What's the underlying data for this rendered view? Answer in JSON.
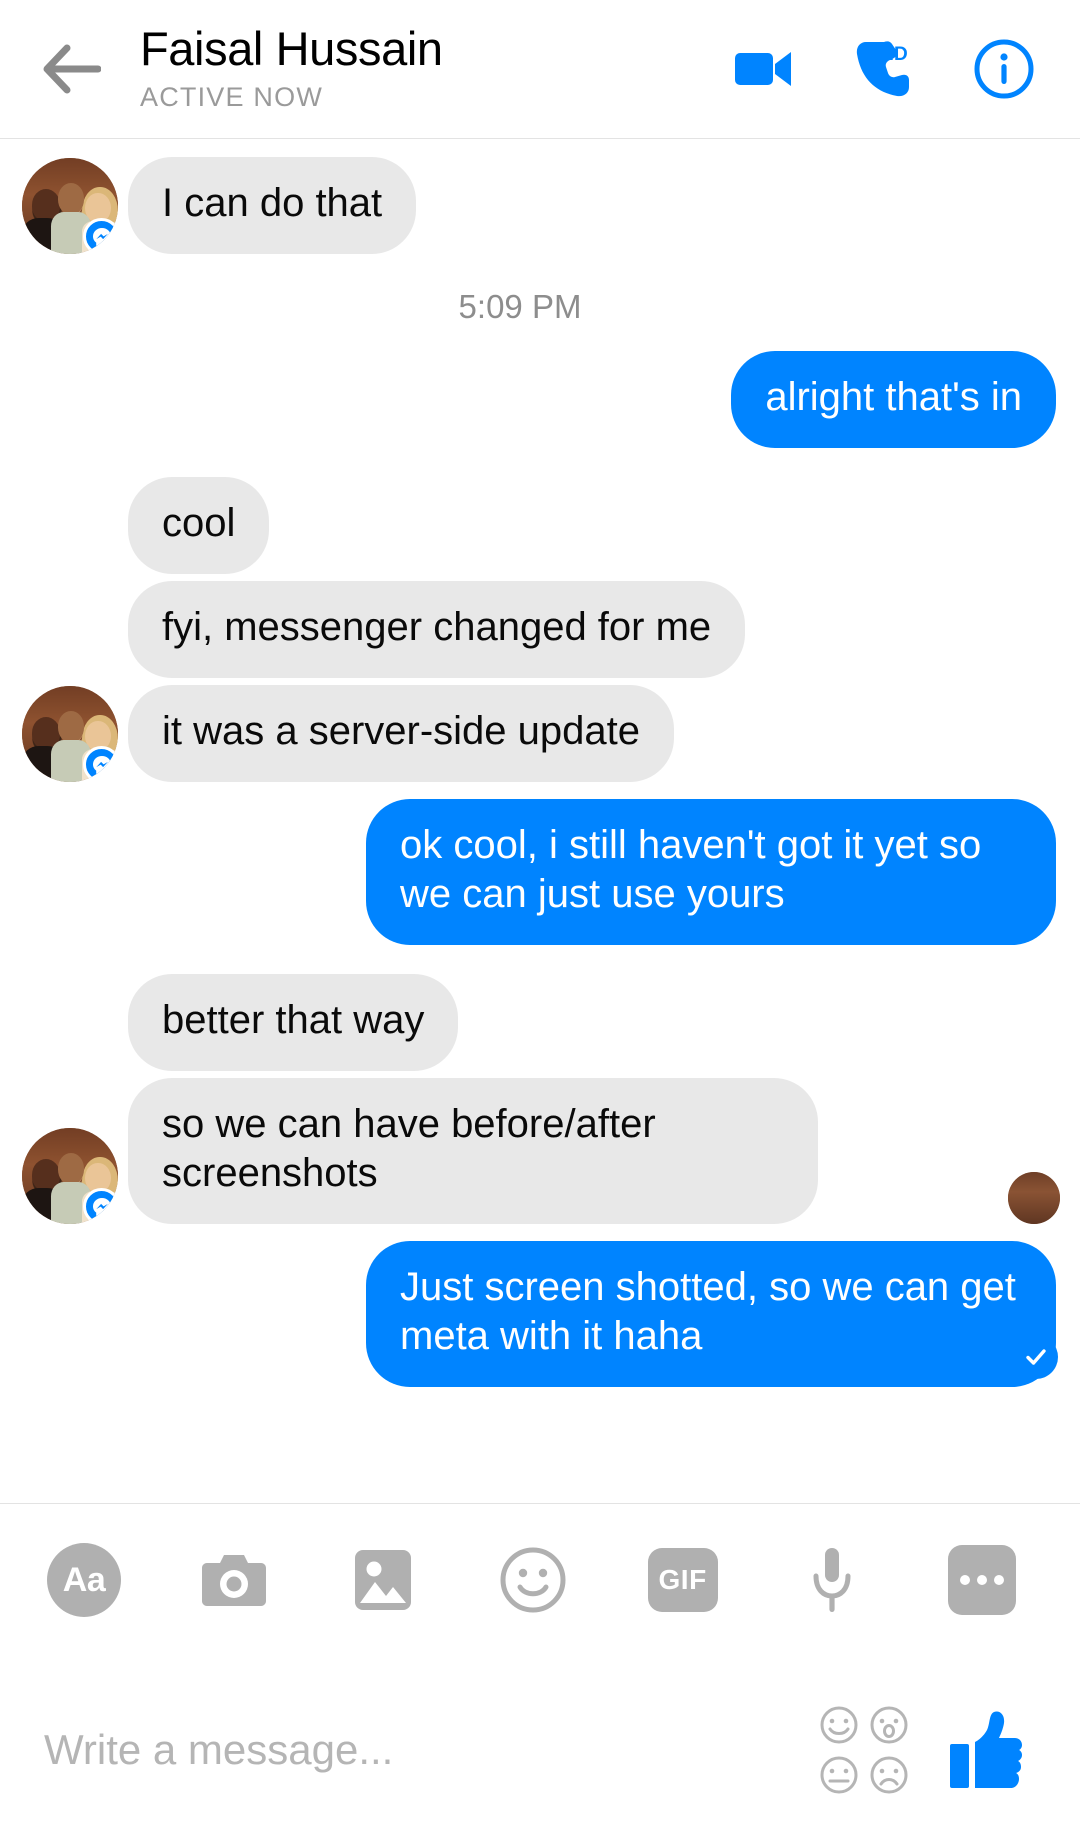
{
  "header": {
    "back_icon": "arrow-left-icon",
    "contact_name": "Faisal Hussain",
    "status": "ACTIVE NOW",
    "video_call_icon": "video-camera-icon",
    "audio_call_icon": "phone-hd-icon",
    "info_icon": "info-circle-icon",
    "accent_color": "#0084ff"
  },
  "thread": {
    "timestamp": "5:09 PM",
    "messages": [
      {
        "id": "m1",
        "side": "in",
        "text": "I can do that",
        "avatar": true,
        "lines": 1
      },
      {
        "id": "m2",
        "side": "out",
        "text": "alright that's in",
        "avatar": false,
        "lines": 1
      },
      {
        "id": "m3",
        "side": "in",
        "text": "cool",
        "avatar": false,
        "lines": 1
      },
      {
        "id": "m4",
        "side": "in",
        "text": "fyi, messenger changed for me",
        "avatar": false,
        "lines": 1
      },
      {
        "id": "m5",
        "side": "in",
        "text": "it was a server-side update",
        "avatar": true,
        "lines": 1
      },
      {
        "id": "m6",
        "side": "out",
        "text": "ok cool, i still haven't got it yet so we can just use yours",
        "avatar": false,
        "lines": 2
      },
      {
        "id": "m7",
        "side": "in",
        "text": "better that way",
        "avatar": false,
        "lines": 1
      },
      {
        "id": "m8",
        "side": "in",
        "text": "so we can have before/after screenshots",
        "avatar": true,
        "lines": 2
      },
      {
        "id": "m9",
        "side": "out",
        "text": "Just screen shotted, so we can get meta with it haha",
        "avatar": false,
        "lines": 2
      }
    ],
    "seen_indicator": "seen-avatar",
    "delivered_icon": "check-circle-icon",
    "bubble_in_color": "#e8e8e8",
    "bubble_out_color": "#0084ff"
  },
  "composer": {
    "tools": [
      {
        "id": "t1",
        "name": "text-format-button",
        "label": "Aa",
        "icon": "aa-icon"
      },
      {
        "id": "t2",
        "name": "camera-button",
        "label": "",
        "icon": "camera-icon"
      },
      {
        "id": "t3",
        "name": "gallery-button",
        "label": "",
        "icon": "photo-icon"
      },
      {
        "id": "t4",
        "name": "sticker-button",
        "label": "",
        "icon": "smiley-icon"
      },
      {
        "id": "t5",
        "name": "gif-button",
        "label": "GIF",
        "icon": "gif-icon"
      },
      {
        "id": "t6",
        "name": "voice-button",
        "label": "",
        "icon": "microphone-icon"
      },
      {
        "id": "t7",
        "name": "more-options-button",
        "label": "",
        "icon": "ellipsis-icon"
      }
    ],
    "input_placeholder": "Write a message...",
    "input_value": "",
    "emoji_picker_icon": "emoji-grid-icon",
    "like_icon": "thumbs-up-icon"
  }
}
